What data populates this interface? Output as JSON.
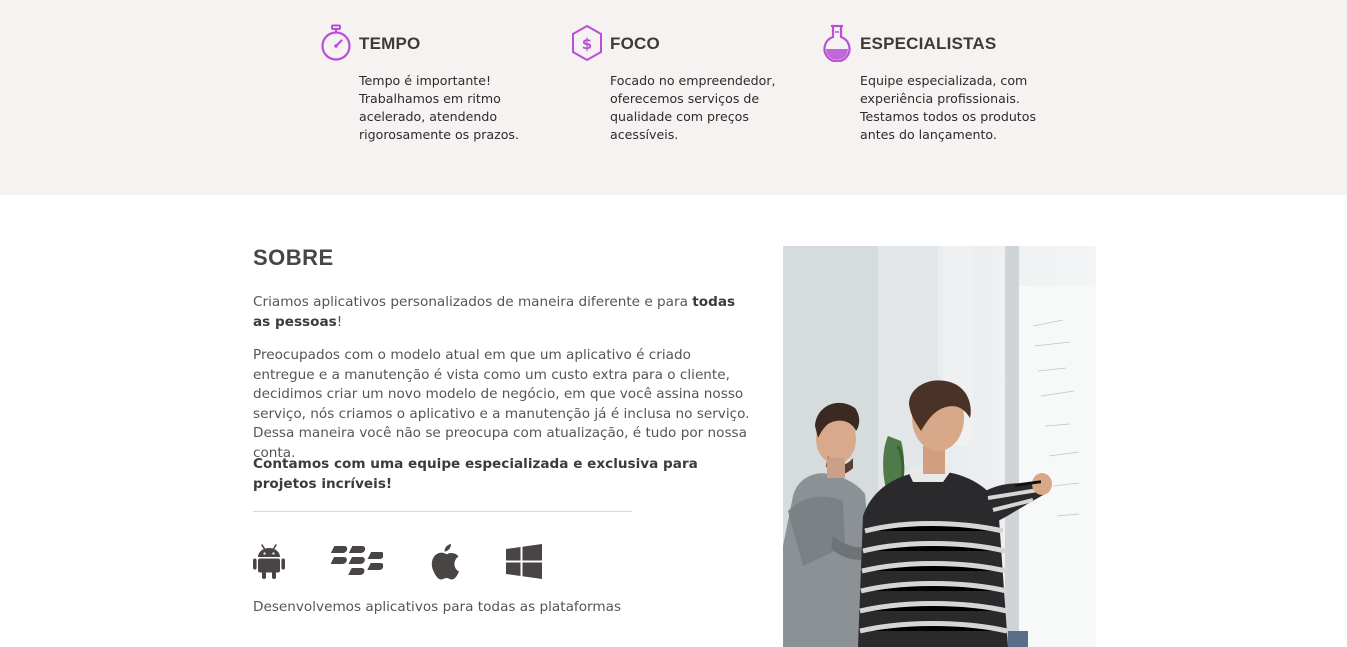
{
  "features": [
    {
      "icon": "stopwatch-icon",
      "title": "TEMPO",
      "desc": "Tempo é importante! Trabalhamos em ritmo acelerado, atendendo rigorosamente os prazos."
    },
    {
      "icon": "dollar-hexagon-icon",
      "title": "FOCO",
      "desc": "Focado no empreendedor, oferecemos serviços de qualidade com preços acessíveis."
    },
    {
      "icon": "flask-icon",
      "title": "ESPECIALISTAS",
      "desc": "Equipe especializada, com experiência profissionais. Testamos todos os produtos antes do lançamento."
    }
  ],
  "about": {
    "title": "SOBRE",
    "p1_start": "Criamos aplicativos personalizados de maneira diferente e para ",
    "p1_bold": "todas as pessoas",
    "p1_end": "!",
    "p2": "Preocupados com o modelo atual em que um aplicativo é criado entregue e a manutenção é vista como um custo extra para o cliente, decidimos criar um novo modelo de negócio, em que você assina nosso serviço, nós criamos o aplicativo e a manutenção já é inclusa no serviço. Dessa maneira você não se preocupa com atualização, é tudo por nossa conta.",
    "p3": "Contamos com uma equipe especializada e exclusiva para projetos incríveis!",
    "platform_icons": [
      "android-icon",
      "blackberry-icon",
      "apple-icon",
      "windows-icon"
    ],
    "platforms_caption": "Desenvolvemos aplicativos para todas as plataformas"
  },
  "colors": {
    "accent": "#b84fd6",
    "features_bg": "#f6f2f1",
    "text_dark": "#3f3a3a"
  }
}
